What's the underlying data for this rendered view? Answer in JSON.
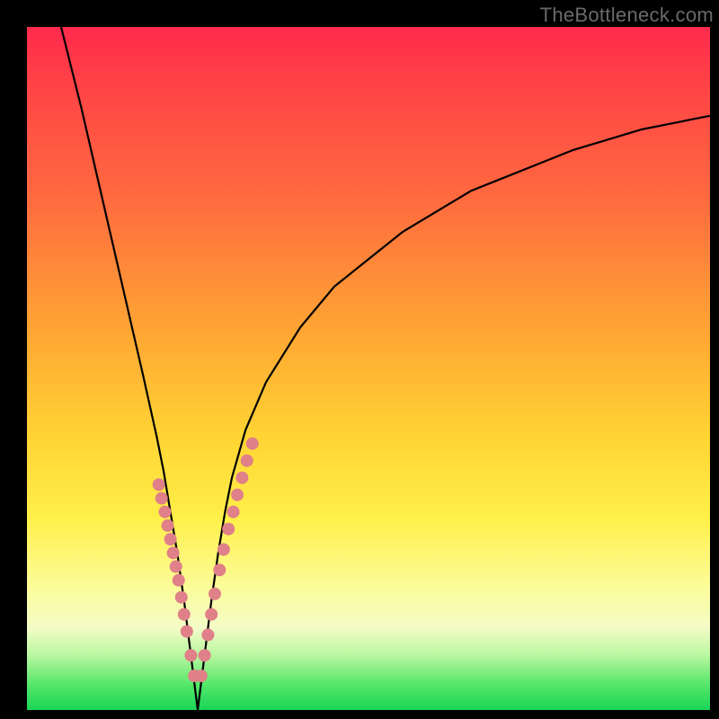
{
  "watermark": "TheBottleneck.com",
  "colors": {
    "frame": "#000000",
    "curve": "#000000",
    "marker": "#e08088",
    "gradient_top": "#ff2a4d",
    "gradient_bottom": "#18d556"
  },
  "chart_data": {
    "type": "line",
    "title": "",
    "xlabel": "",
    "ylabel": "",
    "xlim": [
      0,
      100
    ],
    "ylim": [
      0,
      100
    ],
    "grid": false,
    "note": "V-shaped bottleneck curve. y=100 at top (red/high bottleneck), y=0 at bottom (green/no bottleneck). Minimum at x≈25.",
    "series": [
      {
        "name": "bottleneck-curve",
        "x": [
          5,
          8,
          11,
          14,
          17,
          19,
          20,
          21,
          22,
          23,
          24,
          25,
          26,
          27,
          28,
          29,
          30,
          32,
          35,
          40,
          45,
          50,
          55,
          60,
          65,
          70,
          75,
          80,
          85,
          90,
          95,
          100
        ],
        "y": [
          100,
          88,
          75,
          62,
          49,
          40,
          35,
          29,
          23,
          16,
          8,
          0,
          8,
          16,
          23,
          29,
          34,
          41,
          48,
          56,
          62,
          66,
          70,
          73,
          76,
          78,
          80,
          82,
          83.5,
          85,
          86,
          87
        ]
      }
    ],
    "markers": {
      "name": "highlighted-points",
      "note": "Pink dots clustered on either side of the valley in the lower yellow band (~y 12–33).",
      "x": [
        19.3,
        19.7,
        20.2,
        20.6,
        21.0,
        21.4,
        21.8,
        22.2,
        22.6,
        23.0,
        23.4,
        24.0,
        24.5,
        25.5,
        26.0,
        26.5,
        27.0,
        27.5,
        28.2,
        28.8,
        29.5,
        30.2,
        30.8,
        31.5,
        32.2,
        33.0
      ],
      "y": [
        33.0,
        31.0,
        29.0,
        27.0,
        25.0,
        23.0,
        21.0,
        19.0,
        16.5,
        14.0,
        11.5,
        8.0,
        5.0,
        5.0,
        8.0,
        11.0,
        14.0,
        17.0,
        20.5,
        23.5,
        26.5,
        29.0,
        31.5,
        34.0,
        36.5,
        39.0
      ]
    }
  }
}
